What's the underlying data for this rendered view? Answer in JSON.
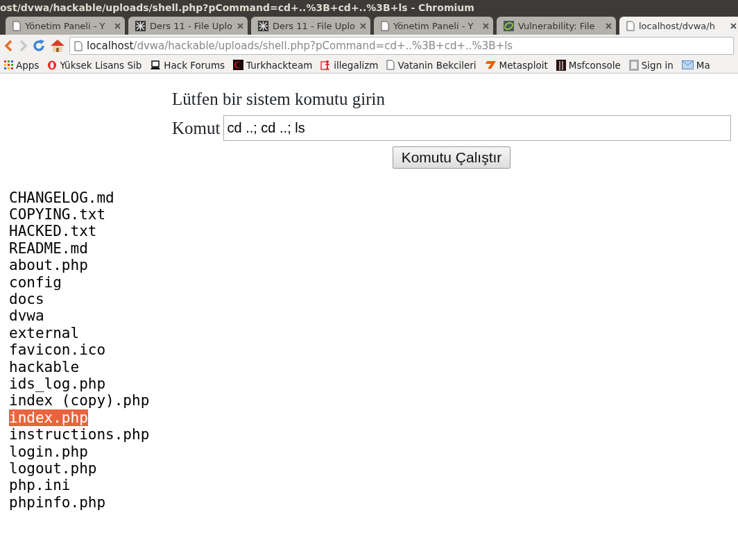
{
  "window": {
    "title": "ost/dvwa/hackable/uploads/shell.php?pCommand=cd+..%3B+cd+..%3B+ls - Chromium"
  },
  "tabs": [
    {
      "label": "Yönetim Paneli - Y",
      "selected": false
    },
    {
      "label": "Ders 11 - File Uplo",
      "selected": false
    },
    {
      "label": "Ders 11 - File Uplo",
      "selected": false
    },
    {
      "label": "Yönetim Paneli - Y",
      "selected": false
    },
    {
      "label": "Vulnerability: File",
      "selected": false
    },
    {
      "label": "localhost/dvwa/h",
      "selected": true
    }
  ],
  "address_bar": {
    "host": "localhost",
    "path": "/dvwa/hackable/uploads/shell.php?pCommand=cd+..%3B+cd+..%3B+ls"
  },
  "bookmarks": [
    "Apps",
    "Yüksek Lisans Sib",
    "Hack Forums",
    "Turkhackteam",
    "illegalizm",
    "Vatanin Bekcileri",
    "Metasploit",
    "Msfconsole",
    "Sign in",
    "Ma"
  ],
  "page": {
    "heading": "Lütfen bir sistem komutu girin",
    "field_label": "Komut",
    "field_value": "cd ..; cd ..; ls",
    "button": "Komutu Çalıştır"
  },
  "files": [
    {
      "name": "CHANGELOG.md",
      "selected": false
    },
    {
      "name": "COPYING.txt",
      "selected": false
    },
    {
      "name": "HACKED.txt",
      "selected": false
    },
    {
      "name": "README.md",
      "selected": false
    },
    {
      "name": "about.php",
      "selected": false
    },
    {
      "name": "config",
      "selected": false
    },
    {
      "name": "docs",
      "selected": false
    },
    {
      "name": "dvwa",
      "selected": false
    },
    {
      "name": "external",
      "selected": false
    },
    {
      "name": "favicon.ico",
      "selected": false
    },
    {
      "name": "hackable",
      "selected": false
    },
    {
      "name": "ids_log.php",
      "selected": false
    },
    {
      "name": "index (copy).php",
      "selected": false
    },
    {
      "name": "index.php",
      "selected": true
    },
    {
      "name": "instructions.php",
      "selected": false
    },
    {
      "name": "login.php",
      "selected": false
    },
    {
      "name": "logout.php",
      "selected": false
    },
    {
      "name": "php.ini",
      "selected": false
    },
    {
      "name": "phpinfo.php",
      "selected": false
    }
  ]
}
